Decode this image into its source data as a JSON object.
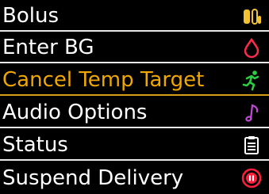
{
  "menu": {
    "items": [
      {
        "label": "Bolus",
        "icon": "bolus-icon",
        "icon_color": "#f2c230"
      },
      {
        "label": "Enter BG",
        "icon": "blood-drop-icon",
        "icon_color": "#ff2b4d"
      },
      {
        "label": "Cancel Temp Target",
        "icon": "running-person-icon",
        "icon_color": "#2ecc40",
        "selected": true
      },
      {
        "label": "Audio Options",
        "icon": "music-note-icon",
        "icon_color": "#c04bd6"
      },
      {
        "label": "Status",
        "icon": "clipboard-icon",
        "icon_color": "#ffffff"
      },
      {
        "label": "Suspend Delivery",
        "icon": "suspend-icon",
        "icon_color": "#ff1f3d"
      }
    ],
    "colors": {
      "background": "#000000",
      "text": "#ffffff",
      "selected_text": "#f0a800",
      "selected_divider": "#d4a017",
      "divider": "#e9e9e9"
    }
  }
}
